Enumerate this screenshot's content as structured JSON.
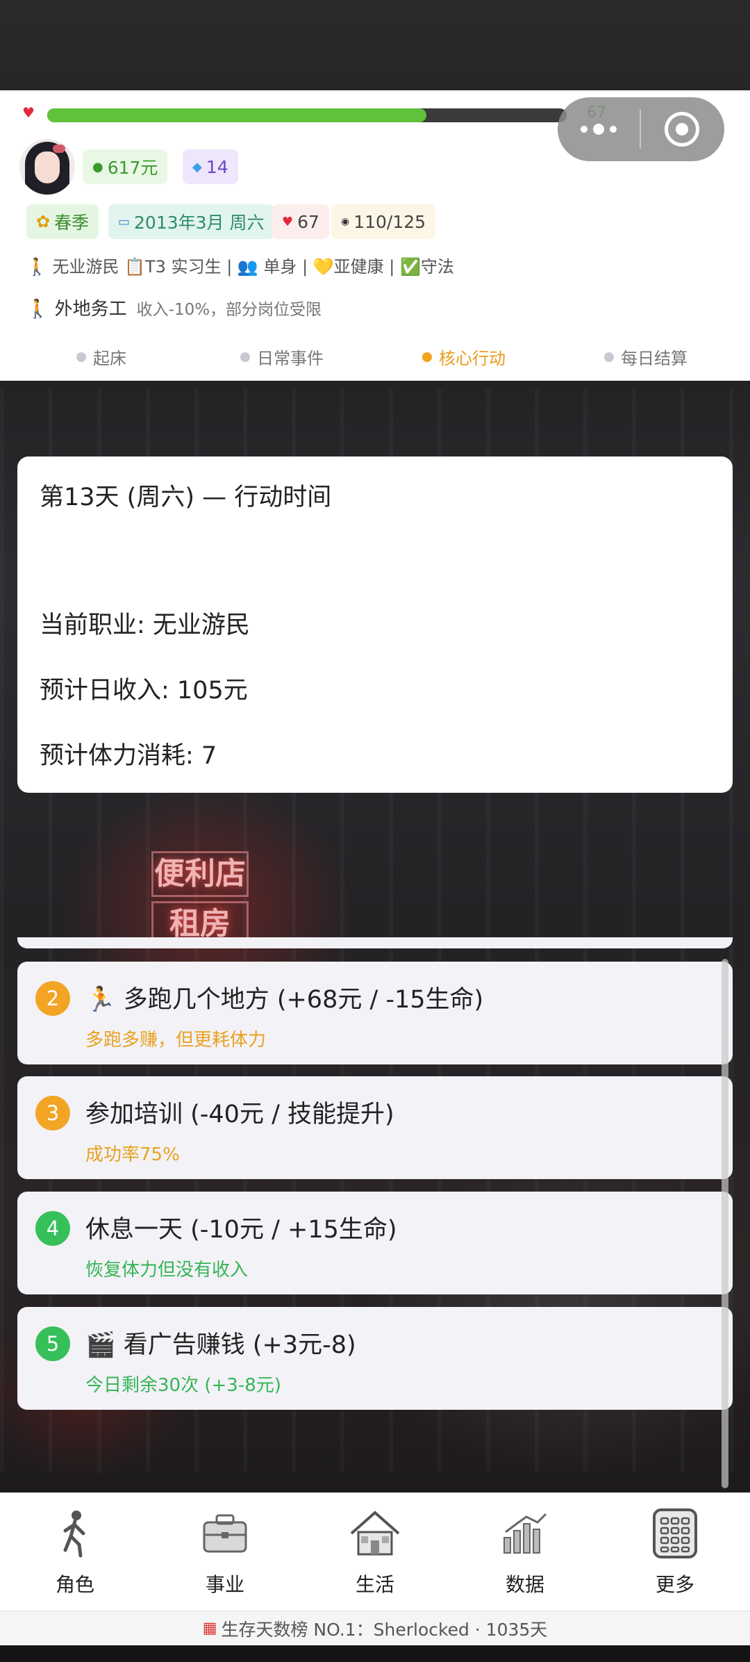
{
  "colors": {
    "health_fill": "#5fc23a",
    "accent_orange": "#f2a525",
    "accent_green": "#37c05a",
    "money_green": "#3a9a2c",
    "gem_purple": "#6d45c4"
  },
  "status": {
    "health_value": "67",
    "health_fraction": 0.73,
    "money": "617元",
    "gems": "14",
    "season": "春季",
    "date": "2013年3月 周六",
    "hearts": "67",
    "energy": "110/125",
    "status_line": "🚶 无业游民 📋T3 实习生 | 👥 单身 | 💛亚健康 | ✅守法",
    "job_name": "🚶 外地务工",
    "job_effect": "收入-10%，部分岗位受限"
  },
  "phases": [
    {
      "label": "起床",
      "active": false
    },
    {
      "label": "日常事件",
      "active": false
    },
    {
      "label": "核心行动",
      "active": true
    },
    {
      "label": "每日结算",
      "active": false
    }
  ],
  "info": {
    "title": "第13天 (周六) — 行动时间",
    "occupation": "当前职业: 无业游民",
    "income": "预计日收入: 105元",
    "stamina": "预计体力消耗: 7"
  },
  "options": [
    {
      "num": "2",
      "label": "🏃 多跑几个地方 (+68元 / -15生命)",
      "sub": "多跑多赚，但更耗体力",
      "color": "orange"
    },
    {
      "num": "3",
      "label": "参加培训 (-40元 / 技能提升)",
      "sub": "成功率75%",
      "color": "orange"
    },
    {
      "num": "4",
      "label": "休息一天 (-10元 / +15生命)",
      "sub": "恢复体力但没有收入",
      "color": "green"
    },
    {
      "num": "5",
      "label": "🎬 看广告赚钱 (+3元-8)",
      "sub": "今日剩余30次 (+3-8元)",
      "color": "green"
    }
  ],
  "nav": [
    {
      "label": "角色",
      "icon": "walking-person-icon"
    },
    {
      "label": "事业",
      "icon": "briefcase-icon"
    },
    {
      "label": "生活",
      "icon": "house-icon"
    },
    {
      "label": "数据",
      "icon": "bar-chart-icon"
    },
    {
      "label": "更多",
      "icon": "calculator-icon"
    }
  ],
  "leaderboard": {
    "icon": "calendar-icon",
    "text": "生存天数榜 NO.1：Sherlocked · 1035天"
  }
}
